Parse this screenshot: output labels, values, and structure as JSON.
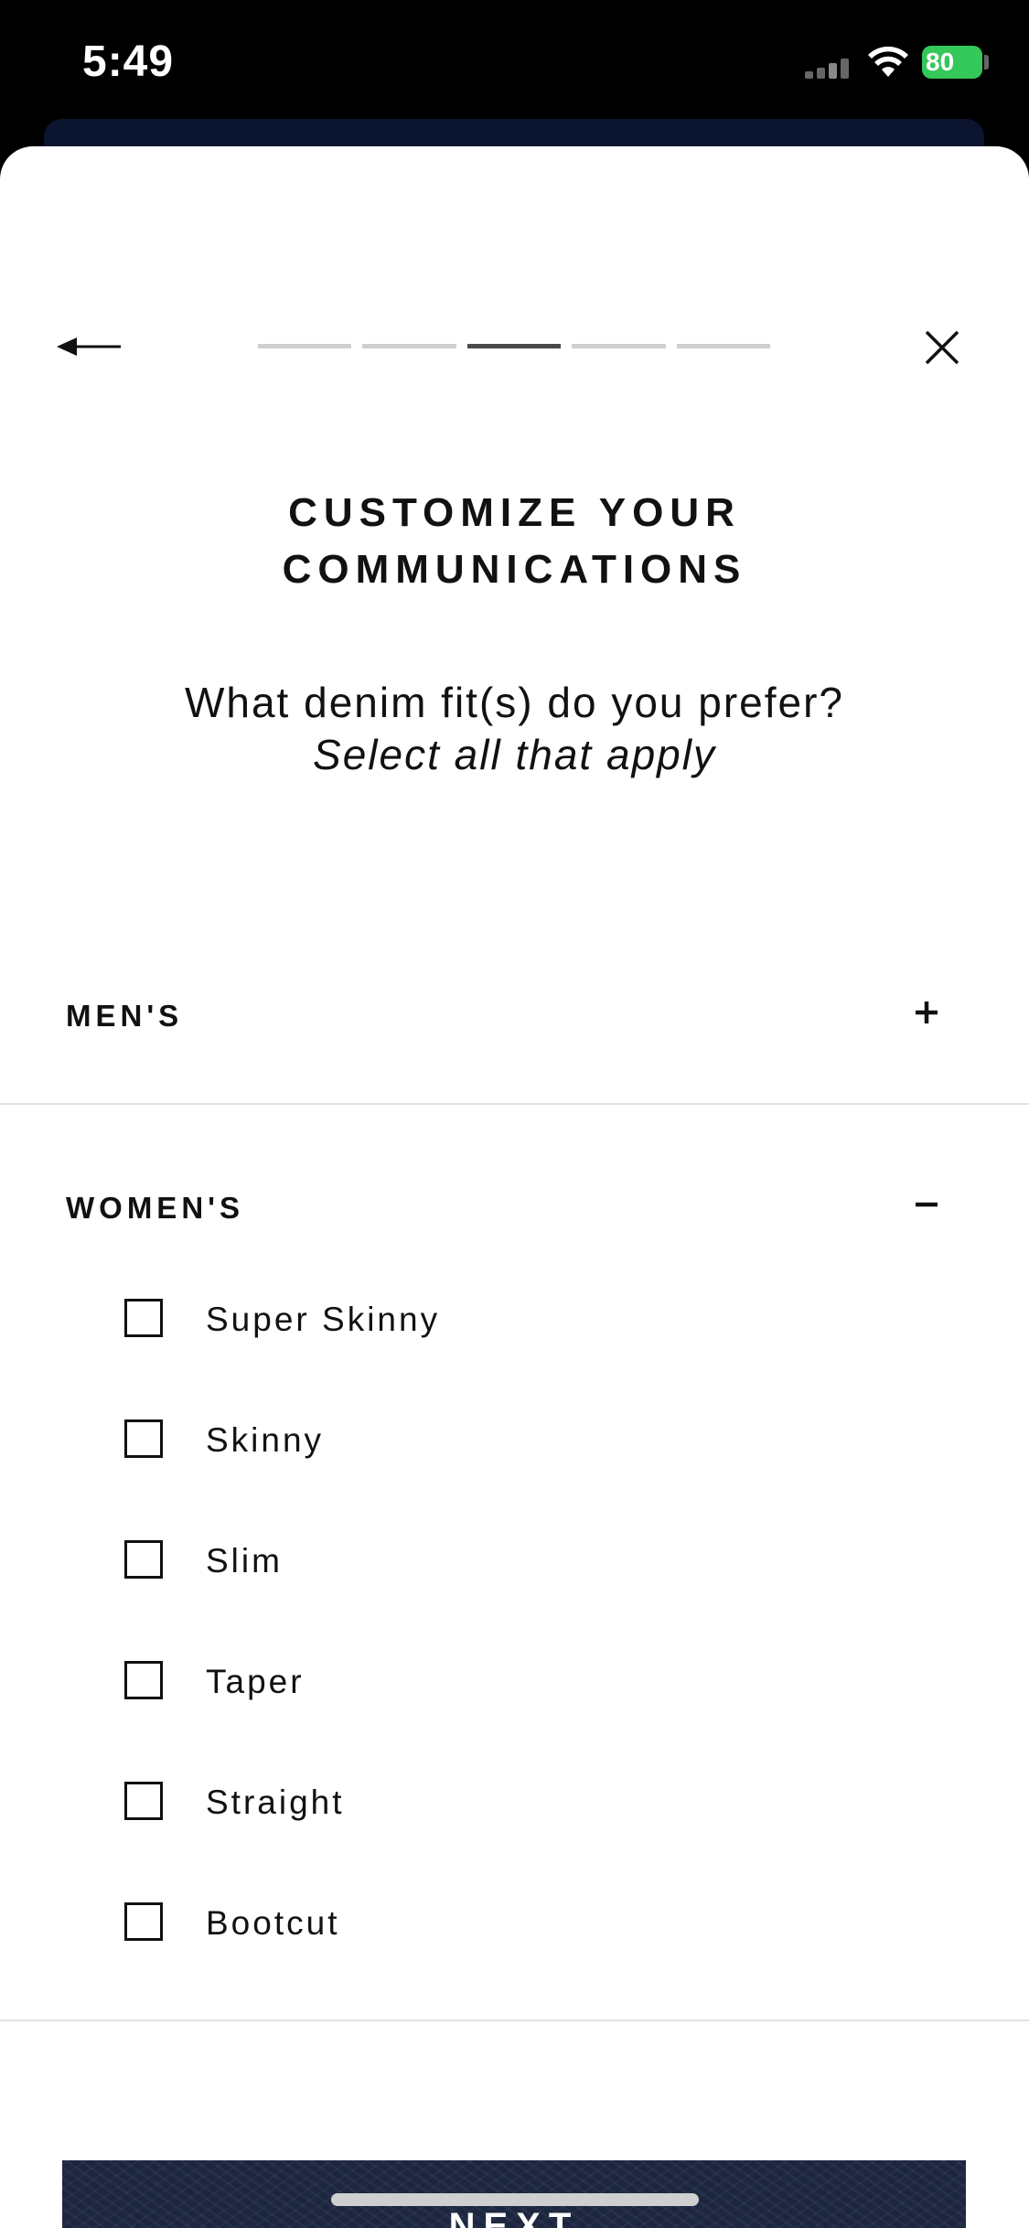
{
  "status_bar": {
    "time": "5:49",
    "battery_level": "80",
    "battery_percent": 80
  },
  "header": {
    "back_icon": "arrow-left-icon",
    "close_icon": "close-icon",
    "progress": {
      "total_steps": 5,
      "current_step": 3
    }
  },
  "content": {
    "title_line1": "CUSTOMIZE YOUR",
    "title_line2": "COMMUNICATIONS",
    "question": "What denim fit(s) do you prefer?",
    "subtitle": "Select all that apply"
  },
  "sections": {
    "mens": {
      "label": "MEN'S",
      "toggle": "+",
      "expanded": false
    },
    "womens": {
      "label": "WOMEN'S",
      "toggle": "−",
      "expanded": true,
      "options": [
        {
          "label": "Super Skinny",
          "checked": false
        },
        {
          "label": "Skinny",
          "checked": false
        },
        {
          "label": "Slim",
          "checked": false
        },
        {
          "label": "Taper",
          "checked": false
        },
        {
          "label": "Straight",
          "checked": false
        },
        {
          "label": "Bootcut",
          "checked": false
        }
      ]
    }
  },
  "footer": {
    "next_label": "NEXT"
  },
  "colors": {
    "accent": "#1c2640",
    "battery": "#34c759",
    "progress_active": "#4a4a4a",
    "progress_inactive": "#cfcfcf"
  }
}
